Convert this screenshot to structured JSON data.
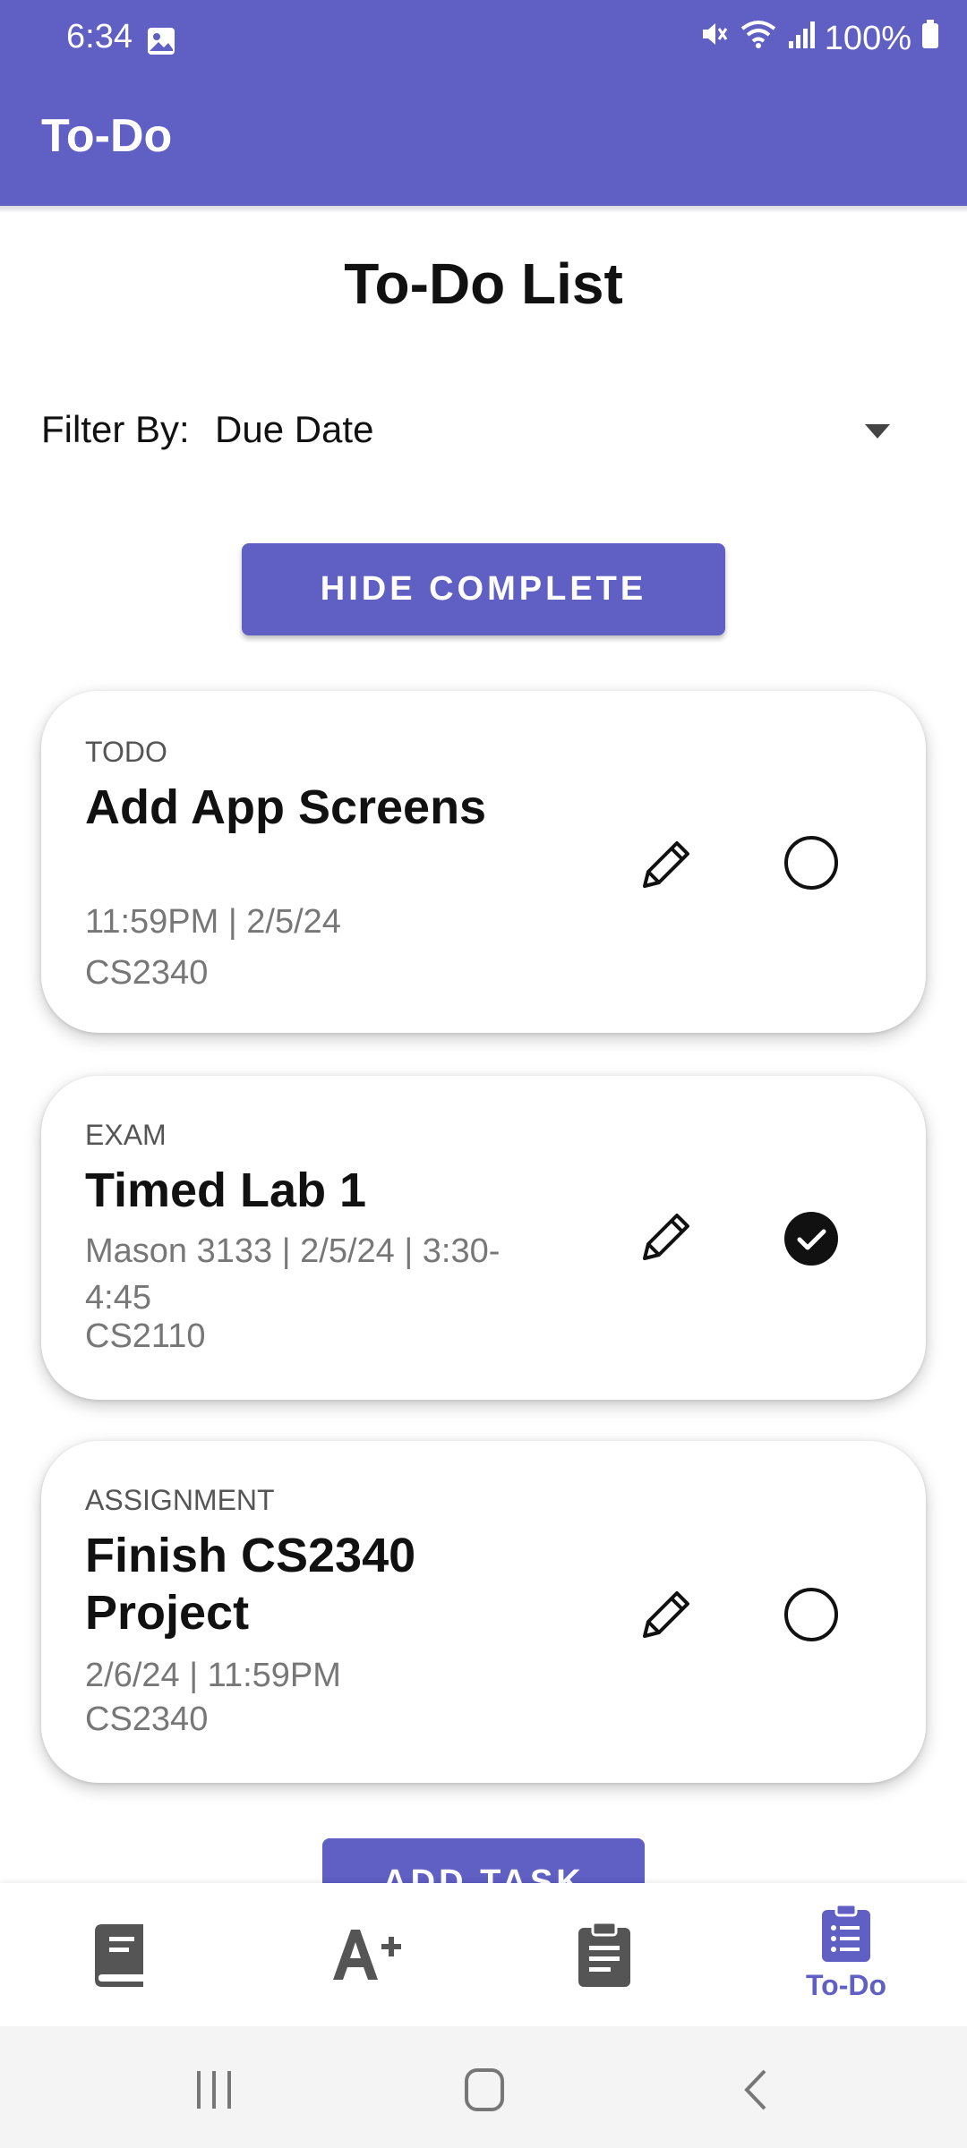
{
  "status_bar": {
    "time": "6:34",
    "battery": "100%"
  },
  "app_bar": {
    "title": "To-Do"
  },
  "page": {
    "title": "To-Do List"
  },
  "filter": {
    "label": "Filter By:",
    "selected": "Due Date"
  },
  "hide_button": {
    "label": "HIDE COMPLETE"
  },
  "tasks": [
    {
      "type": "TODO",
      "title": "Add App Screens",
      "meta": "11:59PM | 2/5/24",
      "course": "CS2340",
      "completed": false
    },
    {
      "type": "EXAM",
      "title": "Timed Lab 1",
      "meta": "Mason 3133 | 2/5/24 | 3:30-4:45",
      "course": "CS2110",
      "completed": true
    },
    {
      "type": "ASSIGNMENT",
      "title": "Finish CS2340 Project",
      "meta": "2/6/24 | 11:59PM",
      "course": "CS2340",
      "completed": false
    }
  ],
  "add_button": {
    "label": "ADD TASK"
  },
  "bottom_nav": {
    "items": [
      {
        "icon": "book-icon",
        "label": ""
      },
      {
        "icon": "grade-icon",
        "label": ""
      },
      {
        "icon": "clipboard-icon",
        "label": ""
      },
      {
        "icon": "checklist-icon",
        "label": "To-Do",
        "active": true
      }
    ]
  },
  "colors": {
    "accent": "#5f5fc4",
    "text": "#111111",
    "muted": "#777777",
    "icon_gray": "#555555"
  }
}
